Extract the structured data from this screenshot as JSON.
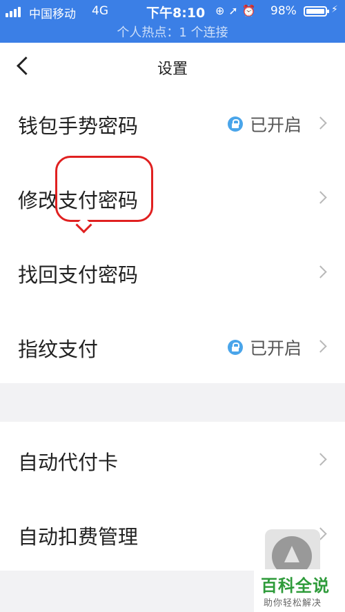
{
  "status_bar": {
    "carrier": "中国移动",
    "network": "4G",
    "time": "下午8:10",
    "battery": "98%",
    "hotspot": "个人热点：1 个连接"
  },
  "nav": {
    "title": "设置"
  },
  "group1": [
    {
      "label": "钱包手势密码",
      "status": "已开启",
      "locked": true
    },
    {
      "label": "修改支付密码",
      "status": "",
      "locked": false
    },
    {
      "label": "找回支付密码",
      "status": "",
      "locked": false
    },
    {
      "label": "指纹支付",
      "status": "已开启",
      "locked": true
    }
  ],
  "group2": [
    {
      "label": "自动代付卡"
    },
    {
      "label": "自动扣费管理"
    }
  ],
  "watermark": {
    "title": "百科全说",
    "subtitle": "助你轻松解决"
  },
  "colors": {
    "status_bar": "#3b7fe6",
    "lock": "#4aa5ea",
    "annotation": "#e02020",
    "watermark": "#2e9b3a"
  }
}
